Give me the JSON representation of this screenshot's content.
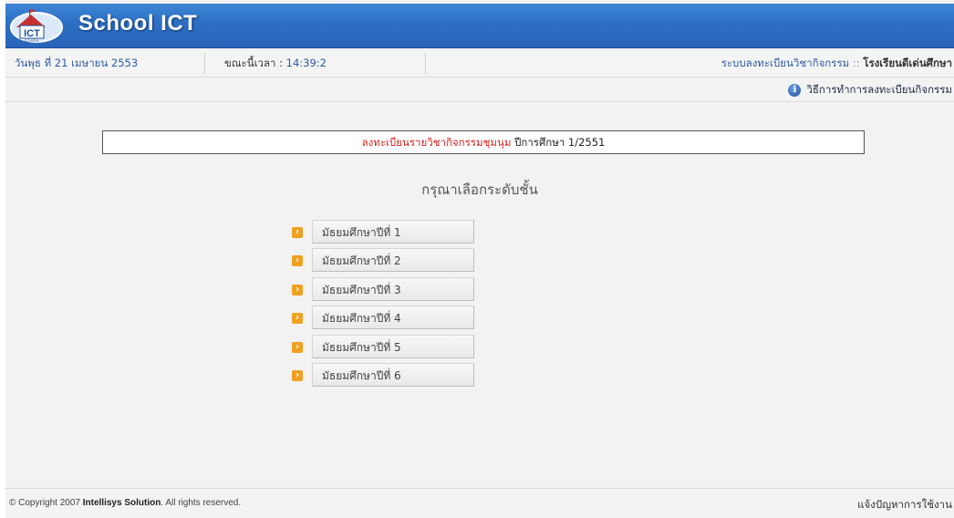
{
  "header": {
    "logo_text": "ICT",
    "logo_subtext": "SCHOOL",
    "title": "School ICT"
  },
  "infobar": {
    "date": "วันพุธ ที่ 21 เมษายน 2553",
    "time_label": "ขณะนี้เวลา :",
    "time_value": "14:39:2",
    "system_label": "ระบบลงทะเบียนวิชากิจกรรม",
    "system_sep": "::",
    "school_name": "โรงเรียนดีเด่นศึกษา"
  },
  "help": {
    "icon": "info-icon",
    "label": "วิธีการทำการลงทะเบียนกิจกรรม"
  },
  "notice": {
    "highlight": "ลงทะเบียนรายวิชากิจกรรมชุมนุม",
    "rest": "ปีการศึกษา 1/2551",
    "highlight_color": "#d62020"
  },
  "prompt": "กรุณาเลือกระดับชั้น",
  "levels": [
    {
      "label": "มัธยมศึกษาปีที่  1"
    },
    {
      "label": "มัธยมศึกษาปีที่  2"
    },
    {
      "label": "มัธยมศึกษาปีที่  3"
    },
    {
      "label": "มัธยมศึกษาปีที่  4"
    },
    {
      "label": "มัธยมศึกษาปีที่  5"
    },
    {
      "label": "มัธยมศึกษาปีที่  6"
    }
  ],
  "level_icon": "arrow-right-icon",
  "footer": {
    "copyright": "© Copyright 2007",
    "company": "Intellisys Solution",
    "rights": ". All rights reserved.",
    "report_link": "แจ้งปัญหาการใช้งาน"
  },
  "colors": {
    "header_blue": "#2b6fc4",
    "accent_orange": "#f0a020",
    "link_blue": "#2c5aa0"
  }
}
